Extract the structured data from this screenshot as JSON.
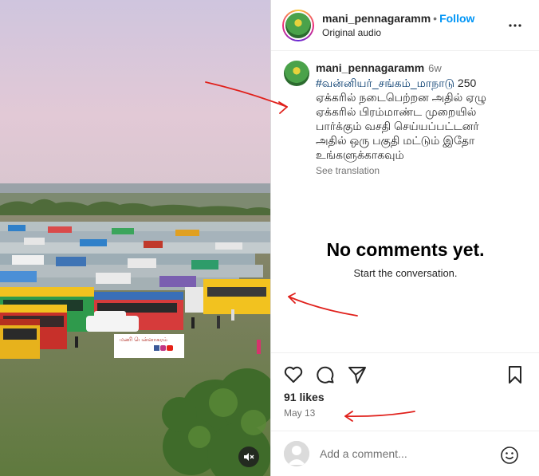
{
  "media": {
    "watermark_text": "மணி பென்னாகரம்",
    "mute_icon": "speaker-muted-icon"
  },
  "header": {
    "username": "mani_pennagaramm",
    "separator": "•",
    "follow_label": "Follow",
    "audio_label": "Original audio",
    "more_icon": "more-horizontal-icon"
  },
  "caption": {
    "username": "mani_pennagaramm",
    "time": "6w",
    "hashtag": "#வன்னியர்_சங்கம்_மாநாடு",
    "text": " 250 ஏக்கரில் நடைபெற்றன அதில் ஏழு ஏக்கரில் பிரம்மாண்ட முறையில் பார்க்கும் வசதி செய்யப்பட்டனர் அதில் ஒரு பகுதி மட்டும் இதோ உங்களுக்காகவும்",
    "see_translation": "See translation"
  },
  "comments": {
    "empty_title": "No comments yet.",
    "empty_subtitle": "Start the conversation."
  },
  "actions": {
    "icons": [
      "heart-icon",
      "comment-icon",
      "share-icon",
      "bookmark-icon"
    ]
  },
  "likes": "91 likes",
  "date": "May 13",
  "comment_input": {
    "placeholder": "Add a comment...",
    "emoji_icon": "emoji-icon"
  },
  "colors": {
    "accent": "#0095f6",
    "hashtag": "#00376b",
    "annotation": "#e0201b"
  }
}
